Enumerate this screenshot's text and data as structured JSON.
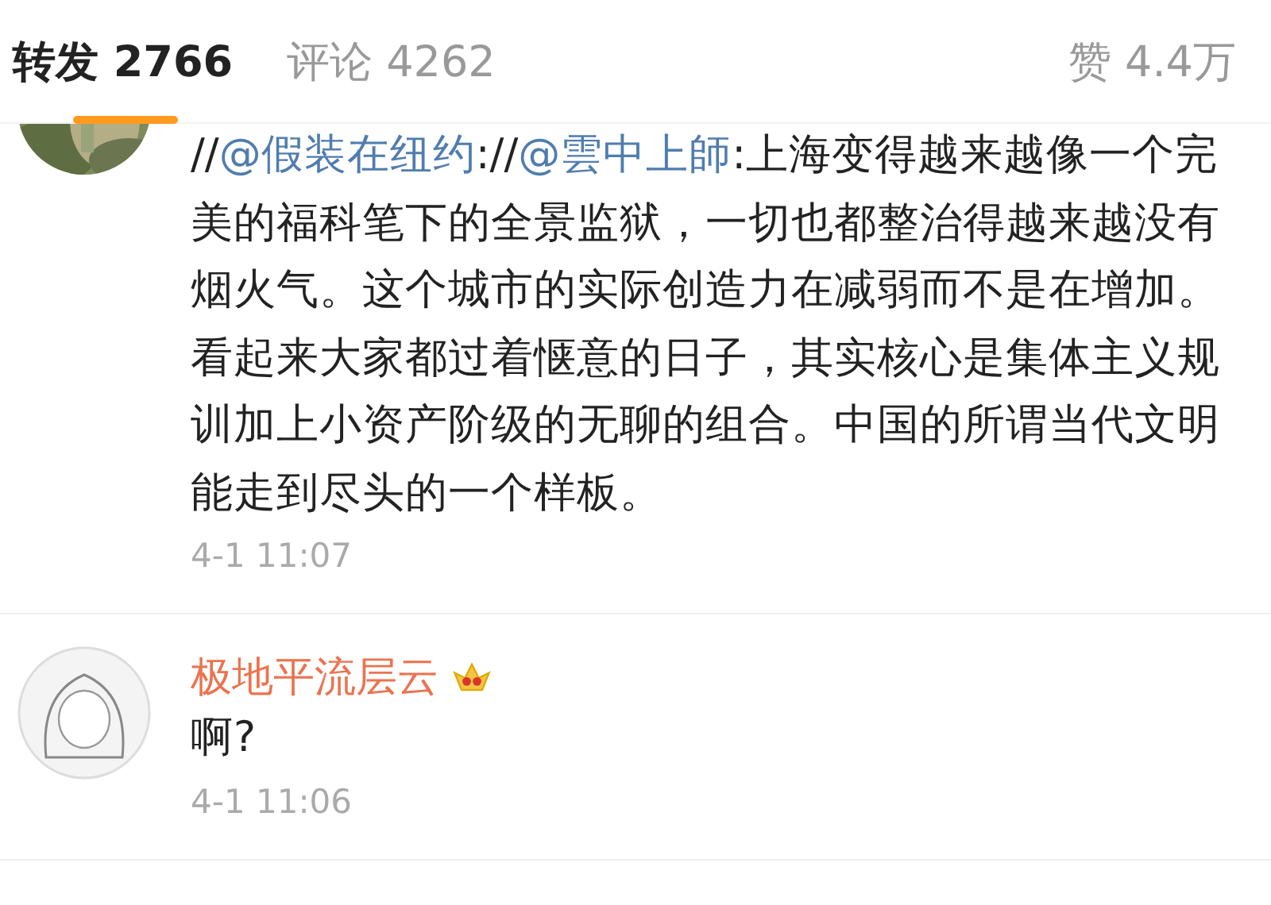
{
  "tabs": [
    {
      "label": "转发",
      "count": "2766",
      "selected": true
    },
    {
      "label": "评论",
      "count": "4262",
      "selected": false
    }
  ],
  "likes": {
    "label": "赞",
    "count": "4.4万"
  },
  "comments": [
    {
      "segments": [
        {
          "kind": "plain",
          "text": "//"
        },
        {
          "kind": "mention",
          "text": "@假装在纽约"
        },
        {
          "kind": "plain",
          "text": ":"
        },
        {
          "kind": "plain",
          "text": "//"
        },
        {
          "kind": "mention",
          "text": "@雲中上師"
        },
        {
          "kind": "plain",
          "text": ":上海变得越来越像一个完美的福科笔下的全景监狱，一切也都整治得越来越没有烟火气。这个城市的实际创造力在减弱而不是在增加。看起来大家都过着惬意的日子，其实核心是集体主义规训加上小资产阶级的无聊的组合。中国的所谓当代文明能走到尽头的一个样板。"
        }
      ],
      "time": "4-1 11:07"
    },
    {
      "avatar": {
        "kind": "drawing"
      },
      "name": "极地平流层云",
      "badge": true,
      "segments": [
        {
          "kind": "plain",
          "text": "啊?"
        }
      ],
      "time": "4-1 11:06"
    }
  ]
}
